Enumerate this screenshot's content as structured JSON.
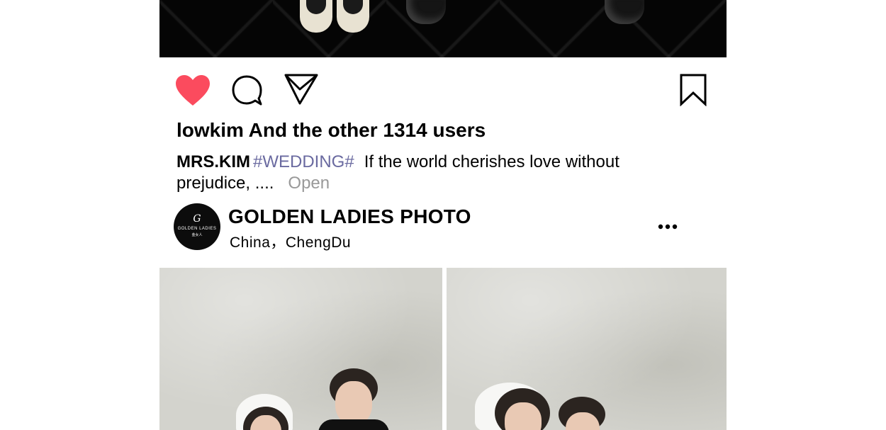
{
  "post": {
    "likes_text": "lowkim And the other 1314 users",
    "caption": {
      "author": "MRS.KIM",
      "hashtag": "#WEDDING#",
      "text": "If the world cherishes love without prejudice, ....",
      "open_label": "Open"
    },
    "actions": {
      "like_icon": "heart-icon",
      "comment_icon": "comment-icon",
      "share_icon": "send-icon",
      "save_icon": "bookmark-icon",
      "like_color": "#fb4b5e"
    },
    "next_post": {
      "account_name": "GOLDEN LADIES PHOTO",
      "location": "China，ChengDu",
      "avatar": {
        "brand": "GOLDEN LADIES",
        "subtitle": "金女人"
      },
      "more_icon": "more-icon"
    }
  }
}
